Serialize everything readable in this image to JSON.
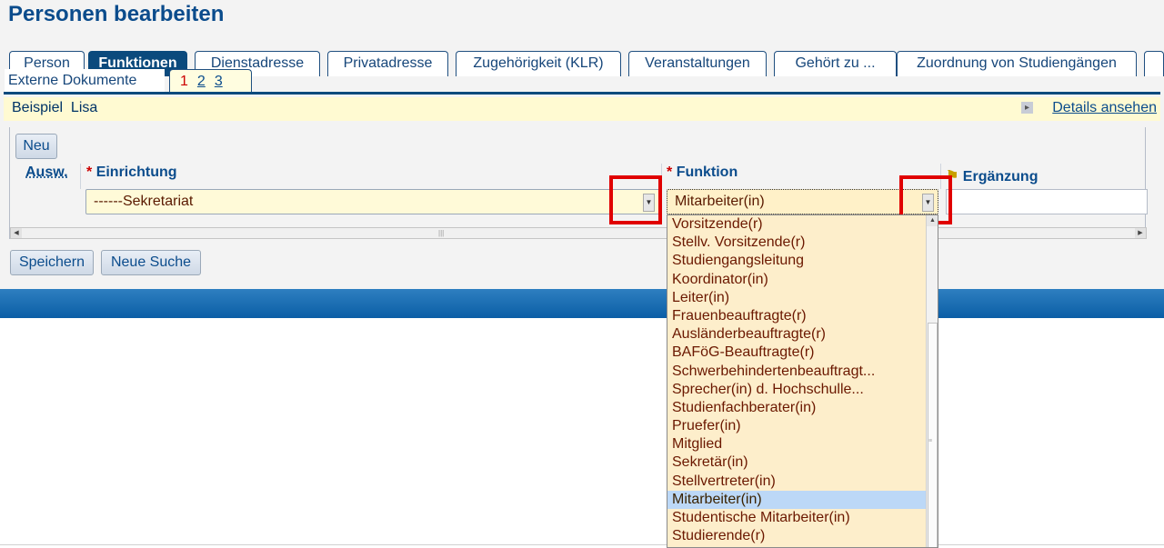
{
  "page": {
    "title": "Personen bearbeiten"
  },
  "tabs": {
    "row1": [
      {
        "label": "Person"
      },
      {
        "label": "Funktionen",
        "active": true
      },
      {
        "label": "Dienstadresse"
      },
      {
        "label": "Privatadresse"
      },
      {
        "label": "Zugehörigkeit (KLR)"
      },
      {
        "label": "Veranstaltungen"
      },
      {
        "label": "Gehört zu ..."
      },
      {
        "label": "Zuordnung von Studiengängen"
      }
    ],
    "row2": [
      {
        "label": "Externe Dokumente"
      }
    ],
    "pages": [
      "1",
      "2",
      "3"
    ],
    "current_page": "1"
  },
  "person": {
    "first_name": "Beispiel",
    "last_name": "Lisa"
  },
  "details_link": "Details ansehen",
  "buttons": {
    "new": "Neu",
    "save": "Speichern",
    "new_search": "Neue Suche"
  },
  "columns": {
    "select": "Ausw.",
    "einrichtung": "Einrichtung",
    "funktion": "Funktion",
    "ergaenzung": "Ergänzung",
    "required_marker": "*"
  },
  "row": {
    "einrichtung": "------Sekretariat",
    "funktion": "Mitarbeiter(in)",
    "ergaenzung": ""
  },
  "dropdown": {
    "items": [
      "Vorsitzende(r)",
      "Stellv. Vorsitzende(r)",
      "Studiengangsleitung",
      "Koordinator(in)",
      "Leiter(in)",
      "Frauenbeauftragte(r)",
      "Ausländerbeauftragte(r)",
      "BAFöG-Beauftragte(r)",
      "Schwerbehindertenbeauftragt...",
      "Sprecher(in) d. Hochschulle...",
      "Studienfachberater(in)",
      "Pruefer(in)",
      "Mitglied",
      "Sekretär(in)",
      "Stellvertreter(in)",
      "Mitarbeiter(in)",
      "Studentische Mitarbeiter(in)",
      "Studierende(r)"
    ],
    "selected": "Mitarbeiter(in)"
  },
  "colors": {
    "accent": "#0b4a7d",
    "highlight": "#e00000",
    "info_bar": "#fffad2",
    "dropdown_bg": "#fdeecb",
    "selected_item": "#bcd8f7"
  }
}
